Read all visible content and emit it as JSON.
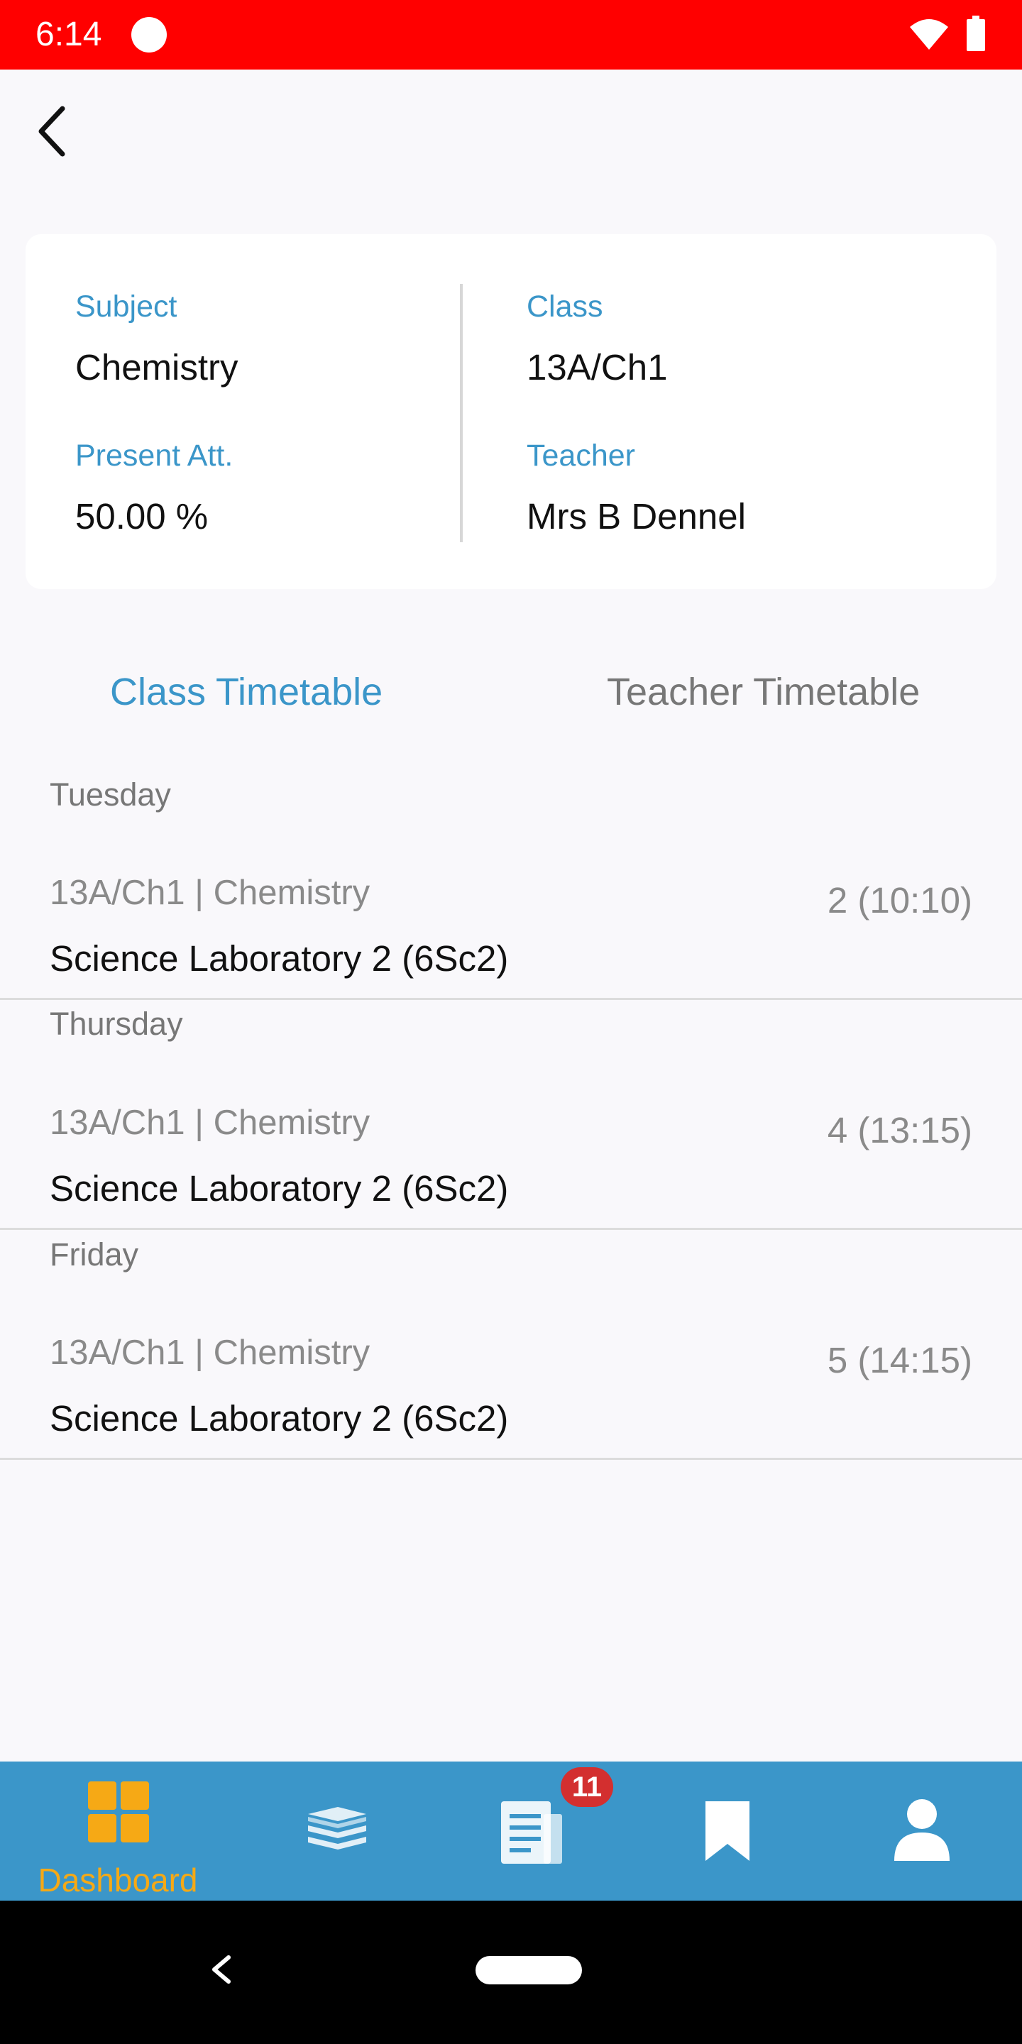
{
  "status_bar": {
    "time": "6:14"
  },
  "info": {
    "subject_label": "Subject",
    "subject_value": "Chemistry",
    "class_label": "Class",
    "class_value": "13A/Ch1",
    "attendance_label": "Present Att.",
    "attendance_value": "50.00 %",
    "teacher_label": "Teacher",
    "teacher_value": "Mrs B Dennel"
  },
  "tabs": [
    {
      "label": "Class Timetable",
      "active": true
    },
    {
      "label": "Teacher Timetable",
      "active": false
    }
  ],
  "timetable": [
    {
      "day": "Tuesday",
      "subject": "13A/Ch1 | Chemistry",
      "room": "Science Laboratory 2 (6Sc2)",
      "period": "2 (10:10)"
    },
    {
      "day": "Thursday",
      "subject": "13A/Ch1 | Chemistry",
      "room": "Science Laboratory 2 (6Sc2)",
      "period": "4 (13:15)"
    },
    {
      "day": "Friday",
      "subject": "13A/Ch1 | Chemistry",
      "room": "Science Laboratory 2 (6Sc2)",
      "period": "5 (14:15)"
    }
  ],
  "bottom_nav": {
    "items": [
      {
        "label": "Dashboard",
        "icon": "dashboard-icon",
        "active": true
      },
      {
        "icon": "books-icon"
      },
      {
        "icon": "document-icon",
        "badge": "11"
      },
      {
        "icon": "bookmark-icon"
      },
      {
        "icon": "profile-icon"
      }
    ]
  },
  "colors": {
    "status_bar": "#ff0000",
    "accent": "#3b96c9",
    "active_nav": "#f6a915",
    "badge": "#d32f2f"
  }
}
